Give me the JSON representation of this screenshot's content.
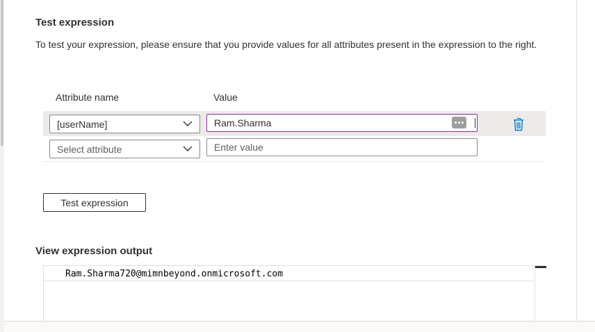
{
  "test_section": {
    "heading": "Test expression",
    "description": "To test your expression, please ensure that you provide values for all attributes present in the expression to the right."
  },
  "table": {
    "col_attribute": "Attribute name",
    "col_value": "Value",
    "rows": [
      {
        "attribute": "[userName]",
        "value": "Ram.Sharma"
      },
      {
        "attribute_placeholder": "Select attribute",
        "value_placeholder": "Enter value"
      }
    ]
  },
  "test_button_label": "Test expression",
  "output_section": {
    "heading": "View expression output",
    "text": "Ram.Sharma720@mimnbeyond.onmicrosoft.com"
  },
  "colors": {
    "focus_border": "#8a2da5",
    "delete_icon": "#0078d4",
    "row_highlight": "#edebe9"
  },
  "icons": {
    "dropdown": "chevron-down-icon",
    "more": "more-icon",
    "delete": "trash-icon"
  }
}
